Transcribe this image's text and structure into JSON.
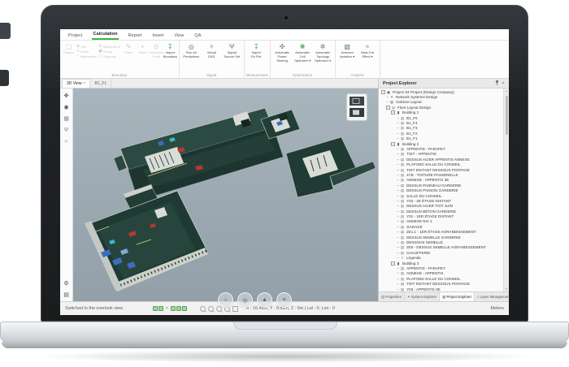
{
  "theme": {
    "accent_green": "#3db54b",
    "ribbon_bg": "#fdfdfd",
    "viewport_bg": "#9fabb4",
    "panel_bg": "#f3f3f3"
  },
  "ribbon": {
    "tabs": [
      {
        "label": "Project",
        "state": "normal"
      },
      {
        "label": "Calculation",
        "state": "active"
      },
      {
        "label": "Report",
        "state": "normal"
      },
      {
        "label": "Insert",
        "state": "normal"
      },
      {
        "label": "View",
        "state": "normal"
      },
      {
        "label": "QA",
        "state": "normal"
      }
    ],
    "group_captions": [
      "Boundary",
      "Signal",
      "Measurement",
      "Optimization",
      "Analysis"
    ],
    "region": {
      "name": "region-button",
      "l1": "Region",
      "l2": " ",
      "glyph": "▢",
      "color": "#c6c6c6",
      "state": "disabled"
    },
    "boundary_minis": [
      {
        "name": "join-button",
        "label": "Join",
        "glyph": "⊕"
      },
      {
        "name": "union-button",
        "label": "Union",
        "glyph": "∪"
      },
      {
        "name": "intersection-button",
        "label": "Intersection",
        "glyph": "∩"
      },
      {
        "name": "difference-button",
        "label": "Difference ▾",
        "glyph": "⊖"
      },
      {
        "name": "group-button",
        "label": "Group",
        "glyph": "▣"
      },
      {
        "name": "ungroup-button",
        "label": "Ungroup",
        "glyph": "▢"
      }
    ],
    "boundary_mids": [
      {
        "name": "trace-button",
        "l1": "Trace",
        "l2": " ",
        "glyph": "✎",
        "color": "#c6c6c6",
        "state": "disabled"
      },
      {
        "name": "point-button",
        "l1": "Point",
        "l2": " ",
        "glyph": "•",
        "color": "#c6c6c6",
        "state": "disabled"
      },
      {
        "name": "calculation-point-button",
        "l1": "Calculation",
        "l2": "Point",
        "glyph": "⊙",
        "color": "#c6c6c6",
        "state": "disabled"
      }
    ],
    "import_boundary": {
      "name": "import-boundary-button",
      "l1": "Import",
      "l2": "Boundary",
      "glyph": "↧",
      "color": "#3db54b",
      "state": "normal"
    },
    "signal_buttons": [
      {
        "name": "run-all-predictions-button",
        "l1": "Run All",
        "l2": "Predictions",
        "glyph": "◎",
        "color": "#5a7a5e",
        "state": "normal"
      },
      {
        "name": "virtual-das-button",
        "l1": "Virtual",
        "l2": "DAS",
        "glyph": "✧",
        "color": "#6a7a74",
        "state": "normal"
      },
      {
        "name": "signal-source-set-button",
        "l1": "Signal",
        "l2": "Source Set",
        "glyph": "Ψ",
        "color": "#6a7a74",
        "state": "normal"
      }
    ],
    "measurement_buttons": [
      {
        "name": "import-rx-file-button",
        "l1": "Import",
        "l2": "Rx File",
        "glyph": "↧",
        "color": "#3db54b",
        "state": "normal"
      }
    ],
    "optimization_buttons": [
      {
        "name": "automatic-power-sharing-button",
        "l1": "Automatic",
        "l2": "Power Sharing",
        "glyph": "✣",
        "color": "#4f7d57",
        "state": "normal"
      },
      {
        "name": "automatic-cell-optimizer-button",
        "l1": "Automatic Cell",
        "l2": "Optimizer ▾",
        "glyph": "❋",
        "color": "#3f8f4a",
        "state": "normal"
      },
      {
        "name": "automatic-topology-optimizer-button",
        "l1": "Automatic Topology",
        "l2": "Optimizer ▾",
        "glyph": "✲",
        "color": "#5a7a5e",
        "state": "normal"
      }
    ],
    "analysis_buttons": [
      {
        "name": "antenna-isolation-button",
        "l1": "Antenna",
        "l2": "Isolation ▾",
        "glyph": "▧",
        "color": "#4f7d57",
        "state": "normal"
      },
      {
        "name": "near-far-effect-button",
        "l1": "Near-Far",
        "l2": "Effect ▾",
        "glyph": "≈",
        "color": "#6a7a74",
        "state": "normal"
      }
    ]
  },
  "doc_tabs": {
    "items": [
      {
        "name": "tab-3d-view",
        "label": "3D View",
        "close": "×",
        "state": "active"
      },
      {
        "name": "tab-b1-f1",
        "label": "B1_F1",
        "close": "",
        "state": "normal"
      }
    ]
  },
  "left_toolbar": {
    "top": [
      {
        "name": "pan-icon",
        "glyph": "✥",
        "tone": "dark"
      },
      {
        "name": "eye-icon",
        "glyph": "◉",
        "tone": "dark"
      },
      {
        "name": "grid-icon",
        "glyph": "▦",
        "tone": "light"
      },
      {
        "name": "antenna-icon",
        "glyph": "Ψ",
        "tone": "light"
      },
      {
        "name": "signal-waves-icon",
        "glyph": "≈",
        "tone": "light"
      }
    ],
    "bottom": [
      {
        "name": "settings-gear-icon",
        "glyph": "⚙",
        "tone": "dark"
      },
      {
        "name": "layers-icon",
        "glyph": "▤",
        "tone": "dark"
      }
    ]
  },
  "viewport": {
    "background": "#9fabb4",
    "model_colors": {
      "dark_wall": "#1d3832",
      "mid_wall": "#24443b",
      "slab_edge": "#ccd2cb",
      "roof_white": "#d9ddd7",
      "accent_red": "#b23931",
      "accent_blue": "#3e6cc0",
      "accent_cyan": "#38b9c7",
      "accent_yellow": "#dcd67e"
    },
    "controls": [
      {
        "name": "home-button",
        "glyph": "⌂"
      },
      {
        "name": "orbit-button",
        "glyph": "◎"
      },
      {
        "name": "walk-button",
        "glyph": "▲"
      },
      {
        "name": "menu-button",
        "glyph": "≡"
      }
    ]
  },
  "explorer": {
    "title": "Project Explorer",
    "close_glyph": "×",
    "items": [
      {
        "level": 0,
        "exp": "open",
        "icon": "project-icon",
        "label": "Project 04 Project (Design Company)"
      },
      {
        "level": 1,
        "exp": "",
        "icon": "network-icon",
        "label": "Network Systems Design"
      },
      {
        "level": 1,
        "exp": "",
        "icon": "outdoor-icon",
        "label": "Outdoor Layout"
      },
      {
        "level": 1,
        "exp": "open",
        "icon": "floor-layout-icon",
        "label": "Floor Layout Design"
      },
      {
        "level": 2,
        "exp": "open",
        "icon": "building-icon",
        "label": "Building 1"
      },
      {
        "level": 3,
        "exp": "",
        "icon": "floor-icon",
        "label": "B1_F5"
      },
      {
        "level": 3,
        "exp": "",
        "icon": "floor-icon",
        "label": "B1_F4"
      },
      {
        "level": 3,
        "exp": "",
        "icon": "floor-icon",
        "label": "B1_F3"
      },
      {
        "level": 3,
        "exp": "",
        "icon": "floor-icon",
        "label": "B1_F2"
      },
      {
        "level": 3,
        "exp": "",
        "icon": "floor-icon",
        "label": "B1_F1"
      },
      {
        "level": 2,
        "exp": "open",
        "icon": "building-icon",
        "label": "Building 2"
      },
      {
        "level": 3,
        "exp": "",
        "icon": "floor-icon",
        "label": "APPENTIS - PARAPET"
      },
      {
        "level": 3,
        "exp": "",
        "icon": "floor-icon",
        "label": "TOIT - APPENTIS"
      },
      {
        "level": 3,
        "exp": "",
        "icon": "floor-icon",
        "label": "DESSUS ACIER APPENTIS ANNEXE"
      },
      {
        "level": 3,
        "exp": "",
        "icon": "floor-icon",
        "label": "PLAFOND SALLE DU CONSEIL"
      },
      {
        "level": 3,
        "exp": "",
        "icon": "floor-icon",
        "label": "TOIT DISTANT DESSOUS PONTAGE"
      },
      {
        "level": 3,
        "exp": "",
        "icon": "floor-icon",
        "label": "2YB - TOITURE PASSERELLE"
      },
      {
        "level": 3,
        "exp": "",
        "icon": "floor-icon",
        "label": "ANNEXE - APPENTIS 3E"
      },
      {
        "level": 3,
        "exp": "",
        "icon": "floor-icon",
        "label": "DESSUS PANNEAU GARDERIE"
      },
      {
        "level": 3,
        "exp": "",
        "icon": "floor-icon",
        "label": "DESSUS PIGNON GARDERIE"
      },
      {
        "level": 3,
        "exp": "",
        "icon": "floor-icon",
        "label": "SALLE DU CONSEIL"
      },
      {
        "level": 3,
        "exp": "",
        "icon": "floor-icon",
        "label": "Y02 - 2E ÉTAGE DISTANT"
      },
      {
        "level": 3,
        "exp": "",
        "icon": "floor-icon",
        "label": "DESSUS ACIER TOIT JUIN"
      },
      {
        "level": 3,
        "exp": "",
        "icon": "floor-icon",
        "label": "DESSUS BÉTON GARDERIE"
      },
      {
        "level": 3,
        "exp": "",
        "icon": "floor-icon",
        "label": "Y01 - 1ER ÉTAGE DISTANT"
      },
      {
        "level": 3,
        "exp": "",
        "icon": "floor-icon",
        "label": "ANNEXE NIV 1"
      },
      {
        "level": 3,
        "exp": "",
        "icon": "floor-icon",
        "label": "GARAGE"
      },
      {
        "level": 3,
        "exp": "",
        "icon": "floor-icon",
        "label": "2E1.1 - 1ER ÉTAGE AGRANDISSEMENT"
      },
      {
        "level": 3,
        "exp": "",
        "icon": "floor-icon",
        "label": "DESSUS SEMELLE GARDERIE"
      },
      {
        "level": 3,
        "exp": "",
        "icon": "floor-icon",
        "label": "DESSOUS SEMELLE"
      },
      {
        "level": 3,
        "exp": "",
        "icon": "floor-icon",
        "label": "2E8 - DESSUS SEMELLE AGRANDISSEMENT"
      },
      {
        "level": 3,
        "exp": "",
        "icon": "floor-icon",
        "label": "CHAUFFERIE"
      },
      {
        "level": 3,
        "exp": "",
        "icon": "legend-icon",
        "label": "Légende"
      },
      {
        "level": 2,
        "exp": "open",
        "icon": "building-icon",
        "label": "Building 3"
      },
      {
        "level": 3,
        "exp": "",
        "icon": "floor-icon",
        "label": "APPENTIS - PARAPET"
      },
      {
        "level": 3,
        "exp": "",
        "icon": "floor-icon",
        "label": "ANNEXE - APPENTIS"
      },
      {
        "level": 3,
        "exp": "",
        "icon": "floor-icon",
        "label": "PLAFOND SALLE DU CONSEIL"
      },
      {
        "level": 3,
        "exp": "",
        "icon": "floor-icon",
        "label": "TOIT DISTANT DESSOUS PONTAGE"
      },
      {
        "level": 3,
        "exp": "",
        "icon": "floor-icon",
        "label": "Y03 - APPENTIS 3E"
      }
    ],
    "panel_tabs": [
      {
        "name": "tab-properties",
        "label": "Properties",
        "glyph": "▤",
        "state": "normal"
      },
      {
        "name": "tab-system-explorer",
        "label": "System Explorer",
        "glyph": "✦",
        "state": "normal"
      },
      {
        "name": "tab-project-explorer",
        "label": "Project Explorer",
        "glyph": "▦",
        "state": "active"
      },
      {
        "name": "tab-layer-management",
        "label": "Layer Management",
        "glyph": "≡",
        "state": "normal"
      }
    ]
  },
  "status_bar": {
    "message": "Switched to the overlook view",
    "grid_separator": "×",
    "coordinates": "X : 16.49m, Y : 9.82m, Z : 0m | Lat : 0, Lon : 0",
    "units": "Meters"
  }
}
